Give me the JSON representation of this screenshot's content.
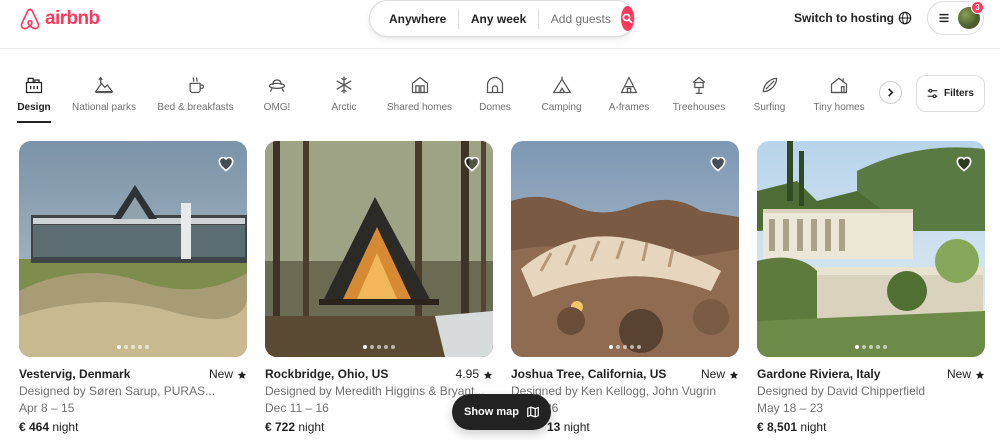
{
  "brand": {
    "name": "airbnb",
    "color": "#ff385c"
  },
  "search": {
    "anywhere": "Anywhere",
    "any_week": "Any week",
    "guests_placeholder": "Add guests",
    "icon": "search-icon"
  },
  "header": {
    "host_link": "Switch to hosting",
    "globe_icon": "globe-icon",
    "menu_icon": "hamburger-icon",
    "notification_count": "3"
  },
  "categories": [
    {
      "label": "Design",
      "icon": "design-icon",
      "active": true
    },
    {
      "label": "National parks",
      "icon": "national-parks-icon"
    },
    {
      "label": "Bed & breakfasts",
      "icon": "bed-breakfast-icon"
    },
    {
      "label": "OMG!",
      "icon": "omg-icon"
    },
    {
      "label": "Arctic",
      "icon": "snowflake-icon"
    },
    {
      "label": "Shared homes",
      "icon": "shared-homes-icon"
    },
    {
      "label": "Domes",
      "icon": "dome-icon"
    },
    {
      "label": "Camping",
      "icon": "camping-icon"
    },
    {
      "label": "A-frames",
      "icon": "a-frame-icon"
    },
    {
      "label": "Treehouses",
      "icon": "treehouse-icon"
    },
    {
      "label": "Surfing",
      "icon": "surfboard-icon"
    },
    {
      "label": "Tiny homes",
      "icon": "tiny-home-icon"
    }
  ],
  "filters": {
    "label": "Filters"
  },
  "listings": [
    {
      "location": "Vestervig, Denmark",
      "rating": "New",
      "designer": "Designed by Søren Sarup, PURAS...",
      "dates": "Apr 8 – 15",
      "price": "€ 464",
      "unit": "night"
    },
    {
      "location": "Rockbridge, Ohio, US",
      "rating": "4.95",
      "designer": "Designed by Meredith Higgins & Bryant...",
      "dates": "Dec 11 – 16",
      "price": "€ 722",
      "unit": "night"
    },
    {
      "location": "Joshua Tree, California, US",
      "rating": "New",
      "designer": "Designed by Ken Kellogg, John Vugrin",
      "dates": "26",
      "price": "13",
      "unit": "night"
    },
    {
      "location": "Gardone Riviera, Italy",
      "rating": "New",
      "designer": "Designed by David Chipperfield",
      "dates": "May 18 – 23",
      "price": "€ 8,501",
      "unit": "night"
    }
  ],
  "show_map": {
    "label": "Show map",
    "icon": "map-icon"
  }
}
